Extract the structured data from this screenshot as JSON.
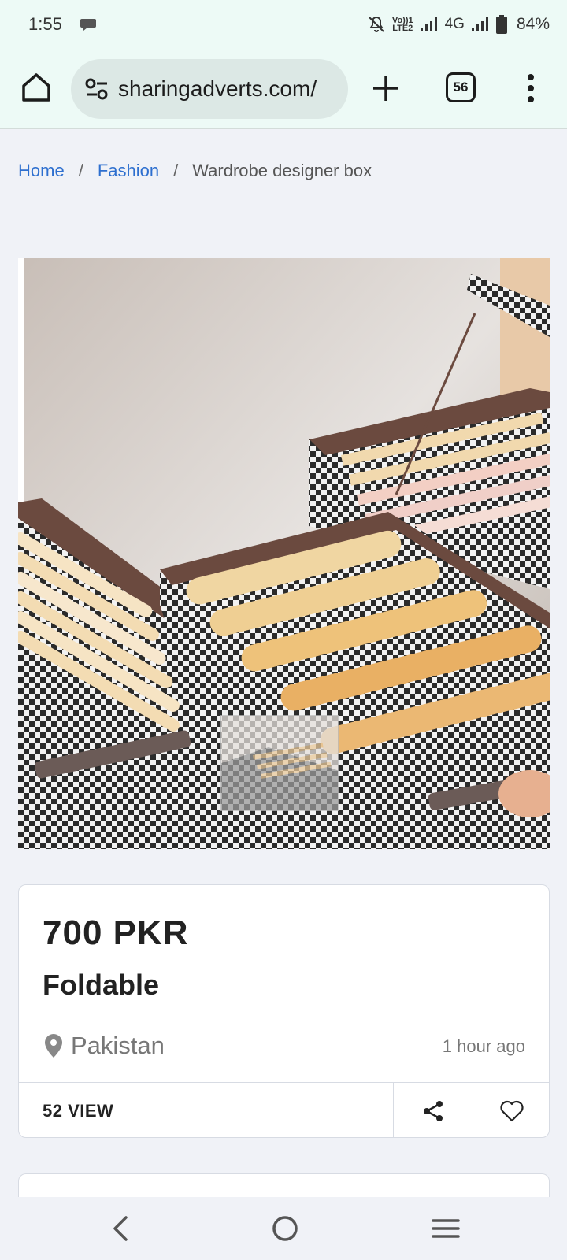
{
  "status_bar": {
    "time": "1:55",
    "volte_line1": "Vo))1",
    "volte_line2": "LTE2",
    "network": "4G",
    "battery": "84%"
  },
  "browser": {
    "url": "sharingadverts.com/",
    "tab_count": "56"
  },
  "breadcrumb": {
    "items": [
      "Home",
      "Fashion"
    ],
    "current": "Wardrobe designer box",
    "separator": "/"
  },
  "listing": {
    "price": "700 PKR",
    "title": "Foldable",
    "location": "Pakistan",
    "posted": "1 hour ago",
    "views": "52 VIEW"
  },
  "colors": {
    "link": "#2d6fcf",
    "toolbar_bg": "#edfaf6",
    "page_bg": "#f0f2f7"
  }
}
